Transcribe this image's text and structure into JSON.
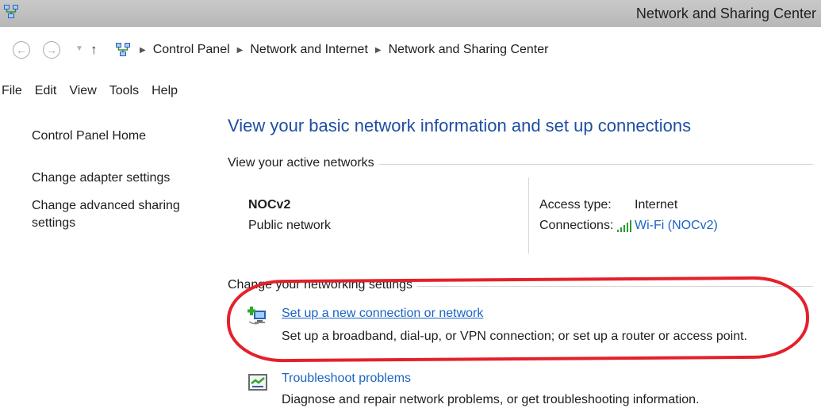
{
  "window": {
    "title": "Network and Sharing Center"
  },
  "address_bar": {
    "back_icon": "back-arrow-icon",
    "forward_icon": "forward-arrow-icon",
    "up_icon": "up-arrow-icon",
    "breadcrumbs": [
      "Control Panel",
      "Network and Internet",
      "Network and Sharing Center"
    ]
  },
  "menu": [
    "File",
    "Edit",
    "View",
    "Tools",
    "Help"
  ],
  "left_pane": {
    "home": "Control Panel Home",
    "adapter": "Change adapter settings",
    "advanced_line1": "Change advanced sharing",
    "advanced_line2": "settings"
  },
  "main": {
    "heading": "View your basic network information and set up connections",
    "active_networks_header": "View your active networks",
    "network": {
      "name": "NOCv2",
      "type": "Public network",
      "access_type_label": "Access type:",
      "access_type_value": "Internet",
      "connections_label": "Connections:",
      "connections_value": "Wi-Fi (NOCv2)"
    },
    "change_settings_header": "Change your networking settings",
    "tasks": [
      {
        "link": "Set up a new connection or network",
        "description": "Set up a broadband, dial-up, or VPN connection; or set up a router or access point.",
        "icon": "new-connection-icon"
      },
      {
        "link": "Troubleshoot problems",
        "description": "Diagnose and repair network problems, or get troubleshooting information.",
        "icon": "troubleshoot-icon"
      }
    ]
  },
  "colors": {
    "heading": "#1e4ea3",
    "link": "#1b64c4",
    "annotation": "#e5202a",
    "titlebar": "#bfbfbf"
  }
}
